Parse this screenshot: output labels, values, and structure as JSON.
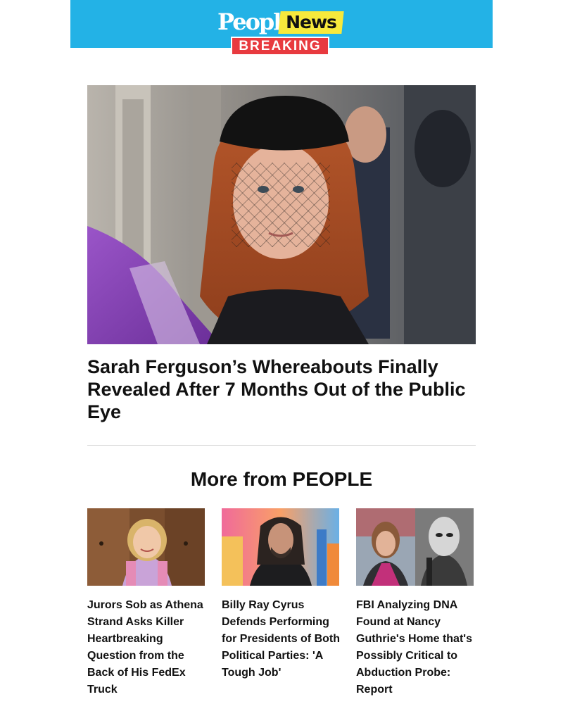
{
  "brand": {
    "logo_people": "People",
    "logo_news": "News",
    "logo_breaking": "BREAKING",
    "header_color": "#23b2e6",
    "accent_yellow": "#f7e93c",
    "accent_red": "#e83a3f"
  },
  "hero": {
    "image_icon": "photo-sarah-ferguson",
    "title": "Sarah Ferguson’s Whereabouts Finally Revealed After 7 Months Out of the Public Eye"
  },
  "more": {
    "heading": "More from PEOPLE",
    "cards": [
      {
        "image_icon": "photo-girl-smiling",
        "title": "Jurors Sob as Athena Strand Asks Killer Heartbreaking Question from the Back of His FedEx Truck"
      },
      {
        "image_icon": "photo-billy-ray-cyrus",
        "title": "Billy Ray Cyrus Defends Performing for Presidents of Both Political Parties: 'A Tough Job'"
      },
      {
        "image_icon": "photo-nancy-guthrie",
        "title": "FBI Analyzing DNA Found at Nancy Guthrie's Home that's Possibly Critical to Abduction Probe: Report"
      }
    ]
  }
}
